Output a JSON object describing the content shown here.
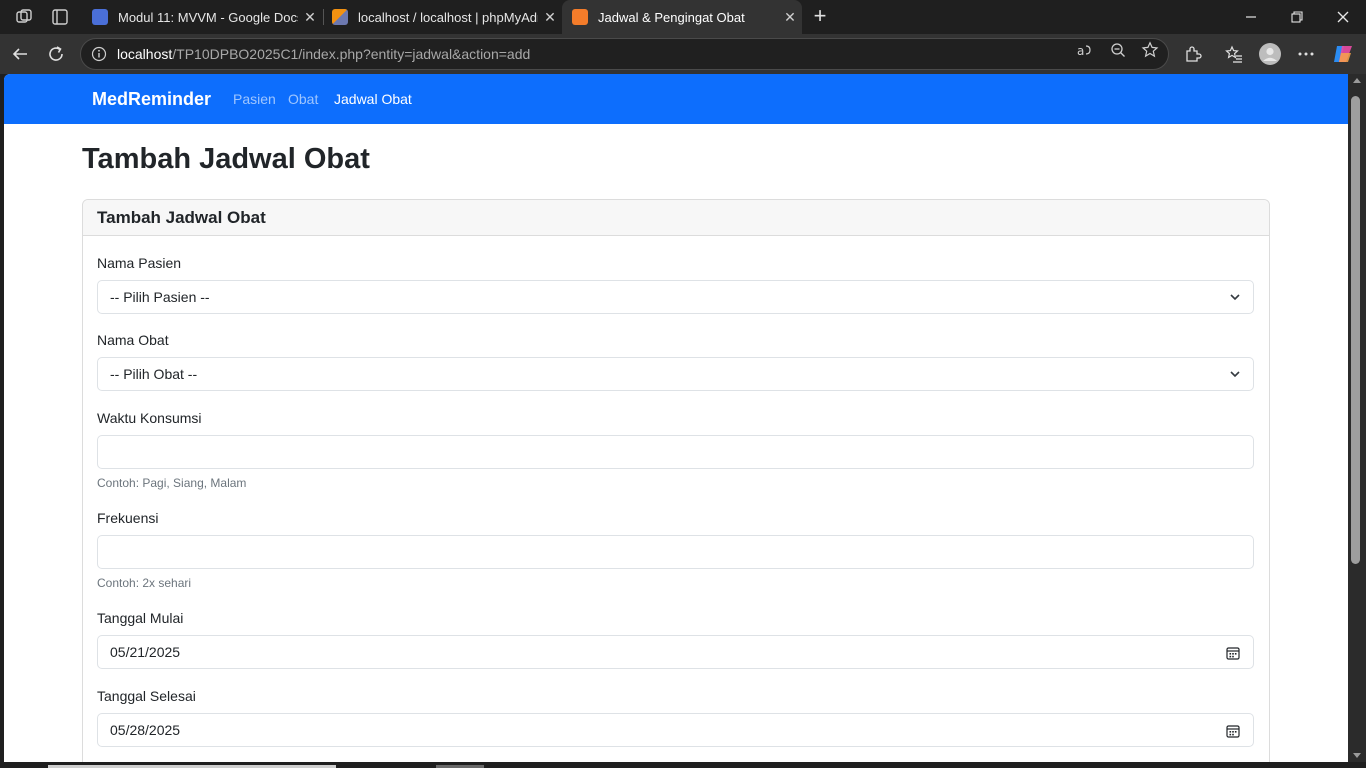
{
  "browser": {
    "tabs": [
      {
        "title": "Modul 11: MVVM - Google Docs",
        "close": "✕"
      },
      {
        "title": "localhost / localhost | phpMyAdmin",
        "close": "✕"
      },
      {
        "title": "Jadwal & Pengingat Obat",
        "close": "✕"
      }
    ],
    "url": {
      "host": "localhost",
      "path": "/TP10DPBO2025C1/index.php?entity=jadwal&action=add"
    },
    "new_tab": "+"
  },
  "navbar": {
    "brand": "MedReminder",
    "links": [
      "Pasien",
      "Obat",
      "Jadwal Obat"
    ]
  },
  "page": {
    "title": "Tambah Jadwal Obat",
    "card_title": "Tambah Jadwal Obat"
  },
  "form": {
    "pasien": {
      "label": "Nama Pasien",
      "value": "-- Pilih Pasien --"
    },
    "obat": {
      "label": "Nama Obat",
      "value": "-- Pilih Obat --"
    },
    "waktu": {
      "label": "Waktu Konsumsi",
      "value": "",
      "help": "Contoh: Pagi, Siang, Malam"
    },
    "frekuensi": {
      "label": "Frekuensi",
      "value": "",
      "help": "Contoh: 2x sehari"
    },
    "tanggal_mulai": {
      "label": "Tanggal Mulai",
      "value": "05/21/2025"
    },
    "tanggal_selesai": {
      "label": "Tanggal Selesai",
      "value": "05/28/2025"
    }
  },
  "colors": {
    "primary": "#0d6efd",
    "chrome_dark": "#1f1f1f",
    "chrome_toolbar": "#333333"
  }
}
